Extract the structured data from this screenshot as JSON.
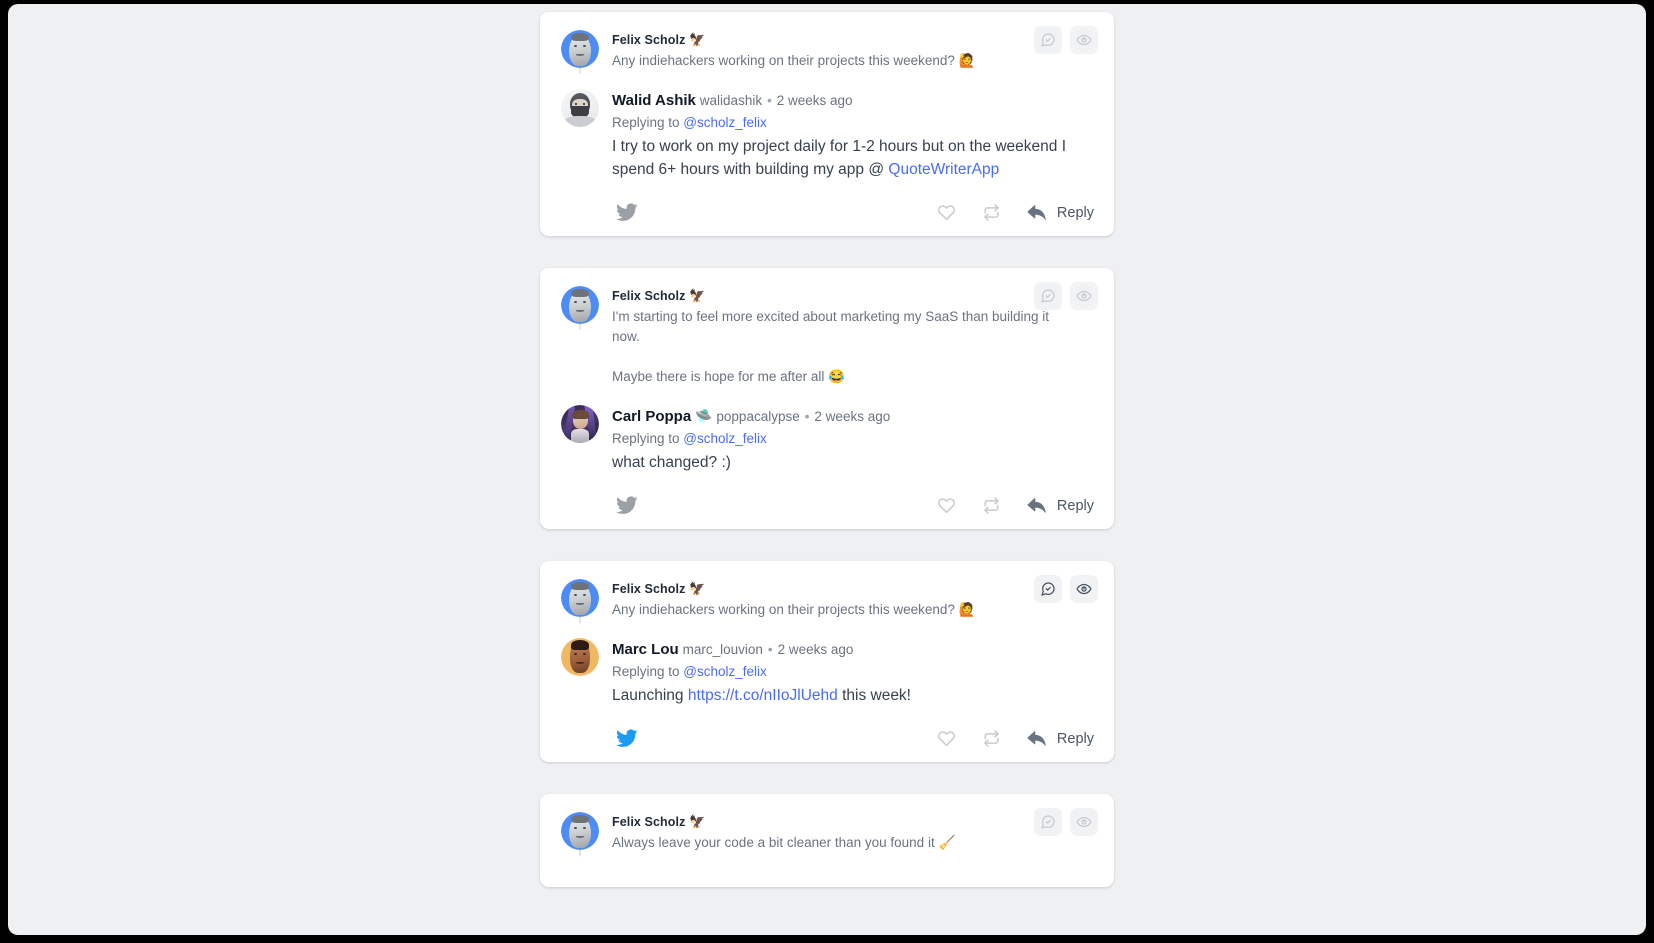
{
  "theme": {
    "page_background": "#eff0f2",
    "card_background": "#ffffff",
    "frame_color": "#000000",
    "link_color": "#4a6cf0",
    "twitter_blue": "#1d9bf0",
    "icon_muted": "#c7cad0",
    "icon_active": "#4b5563",
    "thread_line": "#e3e5e8"
  },
  "icons": {
    "comment_check": "comment-check-icon",
    "eye": "eye-icon",
    "twitter_bird": "twitter-bird-icon",
    "heart": "heart-icon",
    "retweet": "retweet-icon",
    "reply_arrow": "reply-arrow-icon"
  },
  "labels": {
    "reply": "Reply",
    "replying_to_prefix": "Replying to ",
    "separator": "•"
  },
  "cards": [
    {
      "id": "card-1",
      "actions": {
        "comment_state": "muted",
        "eye_state": "muted"
      },
      "twitter_bird_state": "muted",
      "original": {
        "author_name": "Felix Scholz",
        "author_emoji": "🦅",
        "avatar_bg": "#4e8cf5",
        "text": "Any indiehackers working on their projects this weekend? 🙋"
      },
      "reply": {
        "author_name": "Walid Ashik",
        "author_emoji": "",
        "handle": "walidashik",
        "time": "2 weeks ago",
        "replying_to_handle": "@scholz_felix",
        "avatar_bg": "#f1f2f4",
        "text_before": "I try to work on my project daily for 1-2 hours but on the weekend I spend 6+ hours with building my app @ ",
        "link_text": "QuoteWriterApp",
        "text_after": ""
      }
    },
    {
      "id": "card-2",
      "actions": {
        "comment_state": "muted",
        "eye_state": "muted"
      },
      "twitter_bird_state": "muted",
      "original": {
        "author_name": "Felix Scholz",
        "author_emoji": "🦅",
        "avatar_bg": "#4e8cf5",
        "text": "I'm starting to feel more excited about marketing my SaaS than building it now.\n\nMaybe there is hope for me after all 😂"
      },
      "reply": {
        "author_name": "Carl Poppa",
        "author_emoji": "🛸",
        "handle": "poppacalypse",
        "time": "2 weeks ago",
        "replying_to_handle": "@scholz_felix",
        "avatar_bg": "#3d2a55",
        "text_before": "what changed? :)",
        "link_text": "",
        "text_after": ""
      }
    },
    {
      "id": "card-3",
      "actions": {
        "comment_state": "active",
        "eye_state": "active"
      },
      "twitter_bird_state": "blue",
      "original": {
        "author_name": "Felix Scholz",
        "author_emoji": "🦅",
        "avatar_bg": "#4e8cf5",
        "text": "Any indiehackers working on their projects this weekend? 🙋"
      },
      "reply": {
        "author_name": "Marc Lou",
        "author_emoji": "",
        "handle": "marc_louvion",
        "time": "2 weeks ago",
        "replying_to_handle": "@scholz_felix",
        "avatar_bg": "#f0b860",
        "text_before": "Launching ",
        "link_text": "https://t.co/nIIoJlUehd",
        "text_after": " this week!"
      }
    },
    {
      "id": "card-4",
      "actions": {
        "comment_state": "muted",
        "eye_state": "muted"
      },
      "twitter_bird_state": "muted",
      "original": {
        "author_name": "Felix Scholz",
        "author_emoji": "🦅",
        "avatar_bg": "#4e8cf5",
        "text": "Always leave your code a bit cleaner than you found it 🧹"
      },
      "reply": null
    }
  ]
}
